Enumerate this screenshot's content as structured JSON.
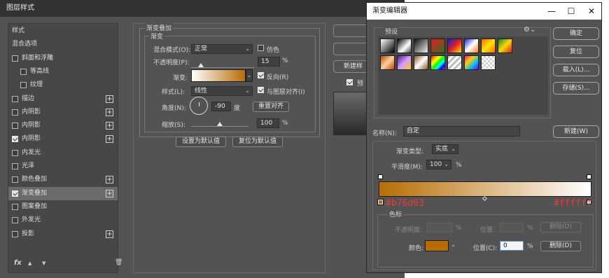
{
  "layer_style": {
    "title": "图层样式",
    "list": {
      "items": [
        {
          "label": "样式",
          "checkbox": false,
          "checked": false,
          "plus": false,
          "indent": 0,
          "selected": false
        },
        {
          "label": "混合选项",
          "checkbox": false,
          "checked": false,
          "plus": false,
          "indent": 0,
          "selected": false
        },
        {
          "label": "斜面和浮雕",
          "checkbox": true,
          "checked": false,
          "plus": false,
          "indent": 0,
          "selected": false
        },
        {
          "label": "等高线",
          "checkbox": true,
          "checked": false,
          "plus": false,
          "indent": 1,
          "selected": false
        },
        {
          "label": "纹理",
          "checkbox": true,
          "checked": false,
          "plus": false,
          "indent": 1,
          "selected": false
        },
        {
          "label": "描边",
          "checkbox": true,
          "checked": false,
          "plus": true,
          "indent": 0,
          "selected": false
        },
        {
          "label": "内阴影",
          "checkbox": true,
          "checked": false,
          "plus": true,
          "indent": 0,
          "selected": false
        },
        {
          "label": "内阴影",
          "checkbox": true,
          "checked": false,
          "plus": true,
          "indent": 0,
          "selected": false
        },
        {
          "label": "内阴影",
          "checkbox": true,
          "checked": true,
          "plus": true,
          "indent": 0,
          "selected": false
        },
        {
          "label": "内发光",
          "checkbox": true,
          "checked": false,
          "plus": false,
          "indent": 0,
          "selected": false
        },
        {
          "label": "光泽",
          "checkbox": true,
          "checked": false,
          "plus": false,
          "indent": 0,
          "selected": false
        },
        {
          "label": "颜色叠加",
          "checkbox": true,
          "checked": false,
          "plus": true,
          "indent": 0,
          "selected": false
        },
        {
          "label": "渐变叠加",
          "checkbox": true,
          "checked": true,
          "plus": true,
          "indent": 0,
          "selected": true
        },
        {
          "label": "图案叠加",
          "checkbox": true,
          "checked": false,
          "plus": false,
          "indent": 0,
          "selected": false
        },
        {
          "label": "外发光",
          "checkbox": true,
          "checked": false,
          "plus": false,
          "indent": 0,
          "selected": false
        },
        {
          "label": "投影",
          "checkbox": true,
          "checked": false,
          "plus": true,
          "indent": 0,
          "selected": false
        }
      ],
      "fx_label": "fx",
      "up_icon": "arrow-up-icon",
      "down_icon": "arrow-down-icon",
      "trash_icon": "trash-icon"
    },
    "gradient_overlay": {
      "section_title": "渐变叠加",
      "group_title": "渐变",
      "blend_mode_label": "混合模式(O):",
      "blend_mode_value": "正常",
      "dither_label": "仿色",
      "dither_checked": false,
      "opacity_label": "不透明度(P):",
      "opacity_value": "15",
      "opacity_fraction": 0.15,
      "opacity_unit": "%",
      "gradient_label": "渐变:",
      "reverse_label": "反向(R)",
      "reverse_checked": true,
      "style_label": "样式(L):",
      "style_value": "线性",
      "align_label": "与图层对齐(I)",
      "align_checked": true,
      "angle_label": "角度(N):",
      "angle_value": "-90",
      "angle_unit": "度",
      "reset_align_label": "重置对齐",
      "scale_label": "缩放(S):",
      "scale_value": "100",
      "scale_fraction": 0.5,
      "scale_unit": "%",
      "set_default_label": "设置为默认值",
      "reset_default_label": "复位为默认值"
    },
    "right_buttons": {
      "ok_label": "确",
      "cancel_label": "取",
      "new_style_label": "新建样",
      "preview_label": "预"
    }
  },
  "gradient_editor": {
    "title": "渐变编辑器",
    "window_controls": {
      "minimize": "—",
      "maximize": "☐",
      "close": "✕"
    },
    "presets_label": "预设",
    "gear_icon": "gear-icon",
    "buttons": {
      "ok": "确定",
      "reset": "复位",
      "load": "载入(L)...",
      "save": "存储(S)...",
      "new": "新建(W)"
    },
    "name_label": "名称(N):",
    "name_value": "自定",
    "type_label": "渐变类型:",
    "type_value": "实底",
    "smoothness_label": "平滑度(M):",
    "smoothness_value": "100",
    "smoothness_unit": "%",
    "gradient_colors": {
      "start": "#b76d03",
      "end": "#ffffff"
    },
    "start_hex_label": "#b76d03",
    "end_hex_label": "#ffffff",
    "stops_group_label": "色标",
    "opacity_label": "不透明度:",
    "opacity_unit": "%",
    "opacity_location_label": "位置:",
    "opacity_location_unit": "%",
    "opacity_delete_label": "删除(D)",
    "color_label": "颜色:",
    "color_value": "#b76d03",
    "color_location_label": "位置(C):",
    "color_location_value": "0",
    "color_location_unit": "%",
    "color_delete_label": "删除(D)"
  }
}
